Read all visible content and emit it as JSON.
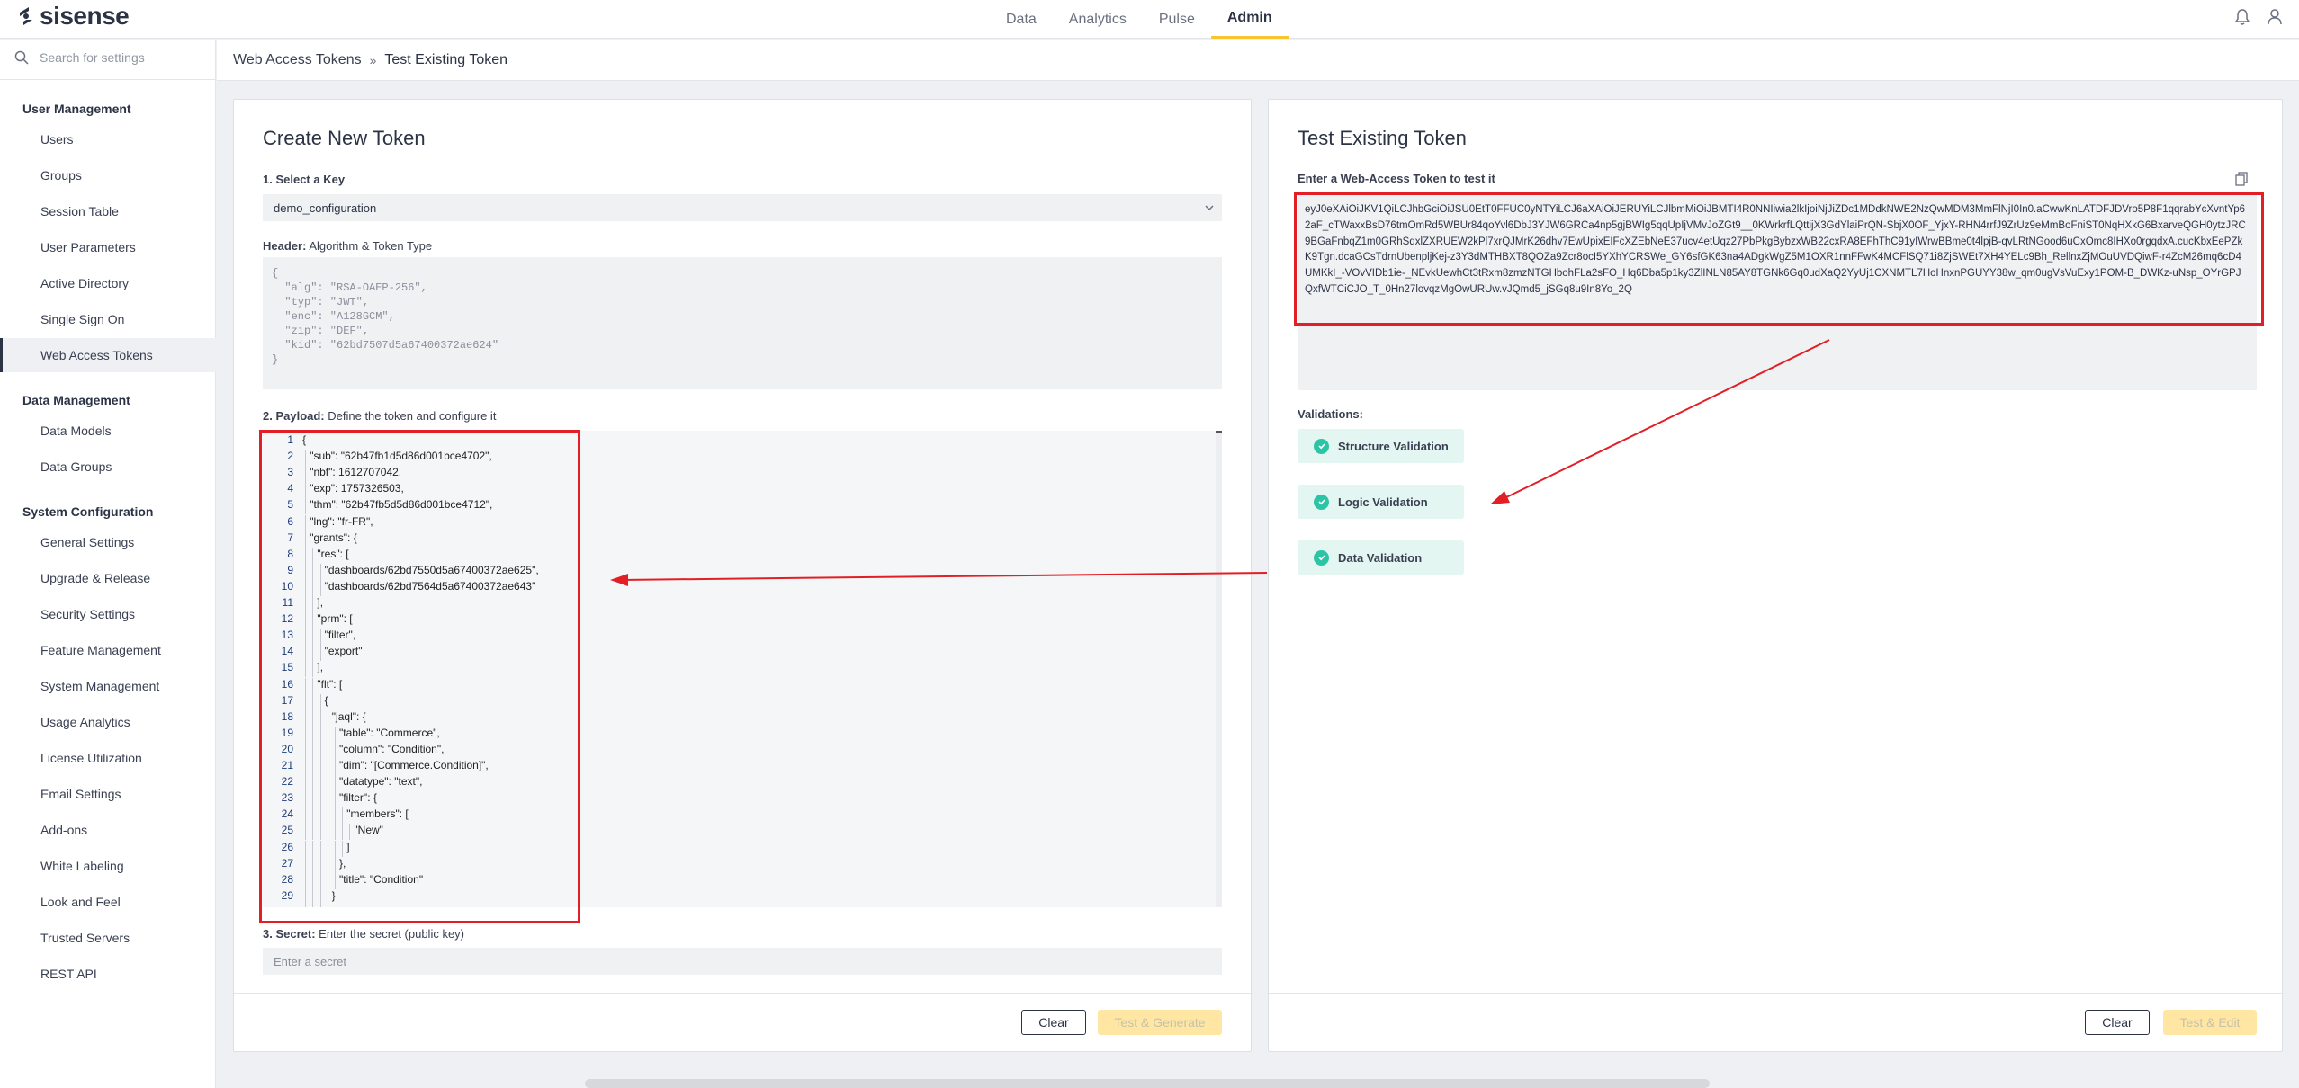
{
  "app": {
    "logo_text": "sisense",
    "nav_tabs": [
      {
        "label": "Data"
      },
      {
        "label": "Analytics"
      },
      {
        "label": "Pulse"
      },
      {
        "label": "Admin",
        "active": true
      }
    ]
  },
  "sidebar": {
    "search_placeholder": "Search for settings",
    "sections": [
      {
        "title": "User Management",
        "items": [
          "Users",
          "Groups",
          "Session Table",
          "User Parameters",
          "Active Directory",
          "Single Sign On",
          "Web Access Tokens"
        ]
      },
      {
        "title": "Data Management",
        "items": [
          "Data Models",
          "Data Groups"
        ]
      },
      {
        "title": "System Configuration",
        "items": [
          "General Settings",
          "Upgrade & Release",
          "Security Settings",
          "Feature Management",
          "System Management",
          "Usage Analytics",
          "License Utilization",
          "Email Settings",
          "Add-ons",
          "White Labeling",
          "Look and Feel",
          "Trusted Servers",
          "REST API"
        ]
      }
    ],
    "active_item": "Web Access Tokens"
  },
  "breadcrumb": {
    "parent": "Web Access Tokens",
    "separator": "»",
    "current": "Test Existing Token"
  },
  "create_panel": {
    "title": "Create New Token",
    "select_key_label": "1. Select a Key",
    "selected_key": "demo_configuration",
    "header_label_bold": "Header:",
    "header_label_rest": " Algorithm & Token Type",
    "header_json": "{\n  \"alg\": \"RSA-OAEP-256\",\n  \"typ\": \"JWT\",\n  \"enc\": \"A128GCM\",\n  \"zip\": \"DEF\",\n  \"kid\": \"62bd7507d5a67400372ae624\"\n}",
    "payload_label_bold": "2. Payload:",
    "payload_label_rest": " Define the token and configure it",
    "payload_lines": [
      "{",
      "\"sub\": \"62b47fb1d5d86d001bce4702\",",
      "\"nbf\": 1612707042,",
      "\"exp\": 1757326503,",
      "\"thm\": \"62b47fb5d5d86d001bce4712\",",
      "\"lng\": \"fr-FR\",",
      "\"grants\": {",
      "\"res\": [",
      "\"dashboards/62bd7550d5a67400372ae625\",",
      "\"dashboards/62bd7564d5a67400372ae643\"",
      "],",
      "\"prm\": [",
      "\"filter\",",
      "\"export\"",
      "],",
      "\"flt\": [",
      "{",
      "\"jaql\": {",
      "\"table\": \"Commerce\",",
      "\"column\": \"Condition\",",
      "\"dim\": \"[Commerce.Condition]\",",
      "\"datatype\": \"text\",",
      "\"filter\": {",
      "\"members\": [",
      "\"New\"",
      "]",
      "},",
      "\"title\": \"Condition\"",
      "}",
      "}"
    ],
    "secret_label_bold": "3. Secret:",
    "secret_label_rest": " Enter the secret (public key)",
    "secret_placeholder": "Enter a secret",
    "clear_button": "Clear",
    "primary_button": "Test & Generate"
  },
  "test_panel": {
    "title": "Test Existing Token",
    "token_label": "Enter a Web-Access Token to test it",
    "token_value": "eyJ0eXAiOiJKV1QiLCJhbGciOiJSU0EtT0FFUC0yNTYiLCJ6aXAiOiJERUYiLCJlbmMiOiJBMTI4R0NNIiwia2lkIjoiNjJiZDc1MDdkNWE2NzQwMDM3MmFlNjI0In0.aCwwKnLATDFJDVro5P8F1qqrabYcXvntYp62aF_cTWaxxBsD76tmOmRd5WBUr84qoYvl6DbJ3YJW6GRCa4np5gjBWIg5qqUpIjVMvJoZGt9__0KWrkrfLQttijX3GdYlaiPrQN-SbjX0OF_YjxY-RHN4rrfJ9ZrUz9eMmBoFniST0NqHXkG6BxarveQGH0ytzJRC9BGaFnbqZ1m0GRhSdxlZXRUEW2kPl7xrQJMrK26dhv7EwUpixEIFcXZEbNeE37ucv4etUqz27PbPkgBybzxWB22cxRA8EFhThC91yIWrwBBme0t4lpjB-qvLRtNGood6uCxOmc8IHXo0rgqdxA.cucKbxEePZkK9Tgn.dcaGCsTdrnUbenpljKej-z3Y3dMTHBXT8QOZa9Zcr8ocI5YXhYCRSWe_GY6sfGK63na4ADgkWgZ5M1OXR1nnFFwK4MCFlSQ71i8ZjSWEt7XH4YELc9Bh_RellnxZjMOuUVDQiwF-r4ZcM26mq6cD4UMKkI_-VOvVIDb1ie-_NEvkUewhCt3tRxm8zmzNTGHbohFLa2sFO_Hq6Dba5p1ky3ZlINLN85AY8TGNk6Gq0udXaQ2YyUj1CXNMTL7HoHnxnPGUYY38w_qm0ugVsVuExy1POM-B_DWKz-uNsp_OYrGPJQxfWTCiCJO_T_0Hn27lovqzMgOwURUw.vJQmd5_jSGq8u9In8Yo_2Q",
    "validations_label": "Validations:",
    "validations": [
      "Structure Validation",
      "Logic Validation",
      "Data Validation"
    ],
    "clear_button": "Clear",
    "primary_button": "Test & Edit"
  },
  "colors": {
    "accent": "#f7c62f",
    "highlight_red": "#e21f26",
    "validation_green": "#2bc4a5"
  }
}
